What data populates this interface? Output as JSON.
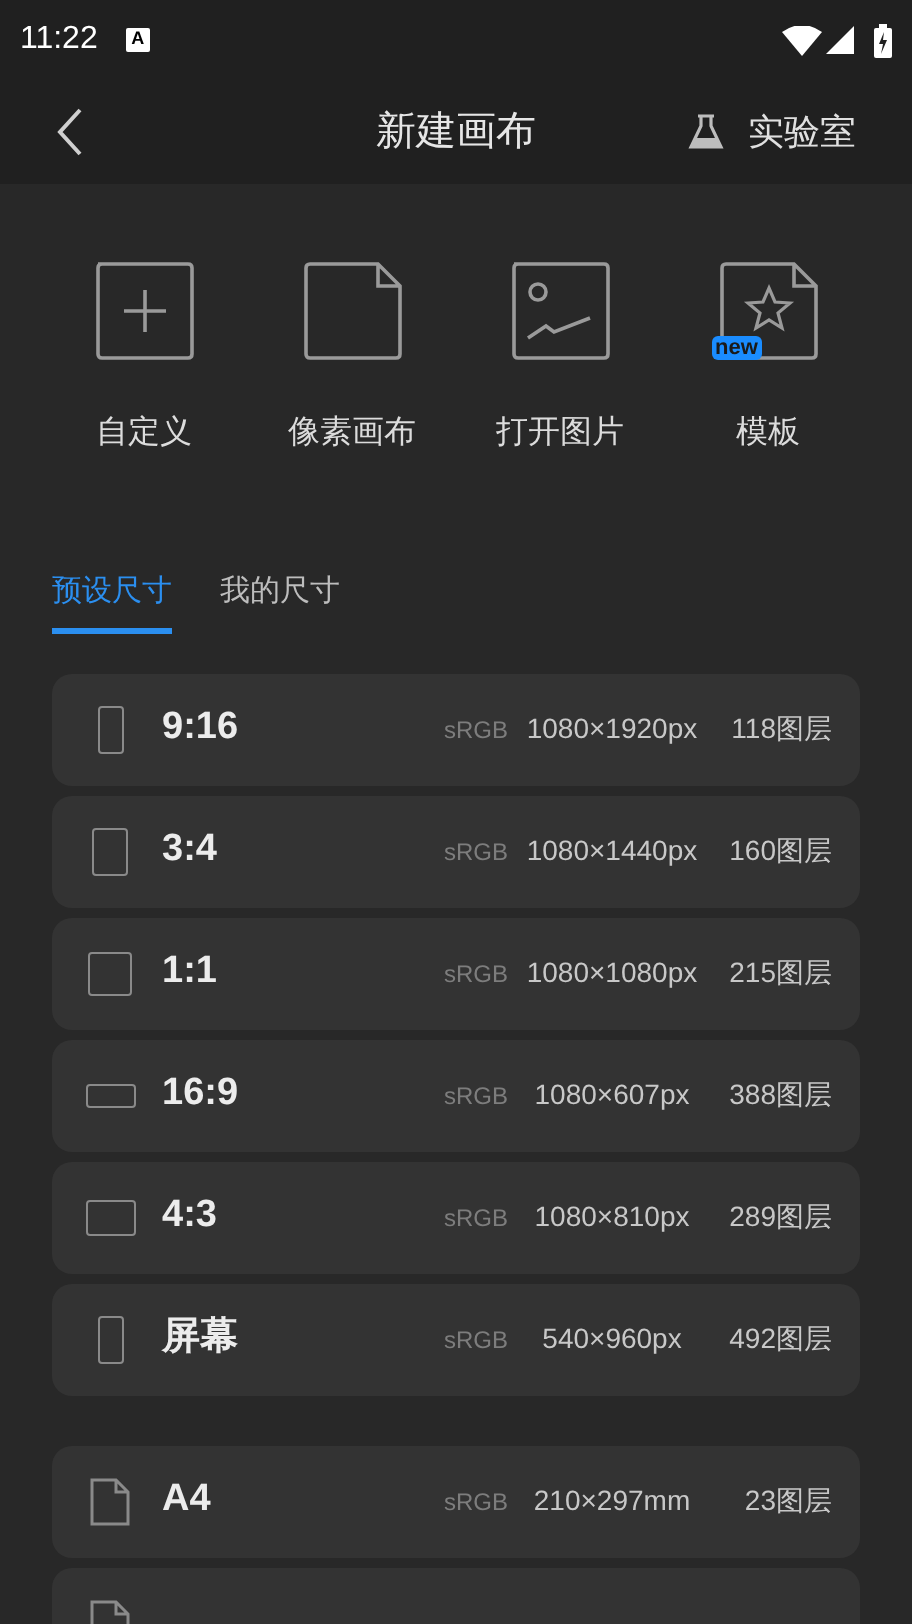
{
  "status_bar": {
    "time": "11:22",
    "notification": "A"
  },
  "header": {
    "title": "新建画布",
    "action": "实验室"
  },
  "actions": [
    {
      "kind": "plus",
      "label": "自定义"
    },
    {
      "kind": "page",
      "label": "像素画布"
    },
    {
      "kind": "image",
      "label": "打开图片"
    },
    {
      "kind": "star",
      "label": "模板",
      "badge": "new"
    }
  ],
  "tabs": [
    {
      "label": "预设尺寸",
      "selected": true
    },
    {
      "label": "我的尺寸",
      "selected": false
    }
  ],
  "groups": [
    [
      {
        "kind": "tall",
        "name": "9:16",
        "color_space": "sRGB",
        "size": "1080×1920px",
        "layers": "118图层"
      },
      {
        "kind": "portrait",
        "name": "3:4",
        "color_space": "sRGB",
        "size": "1080×1440px",
        "layers": "160图层"
      },
      {
        "kind": "square",
        "name": "1:1",
        "color_space": "sRGB",
        "size": "1080×1080px",
        "layers": "215图层"
      },
      {
        "kind": "wide",
        "name": "16:9",
        "color_space": "sRGB",
        "size": "1080×607px",
        "layers": "388图层"
      },
      {
        "kind": "landscape",
        "name": "4:3",
        "color_space": "sRGB",
        "size": "1080×810px",
        "layers": "289图层"
      },
      {
        "kind": "tall",
        "name": "屏幕",
        "color_space": "sRGB",
        "size": "540×960px",
        "layers": "492图层"
      }
    ],
    [
      {
        "kind": "page",
        "name": "A4",
        "color_space": "sRGB",
        "size": "210×297mm",
        "layers": "23图层"
      },
      {
        "kind": "page_cut"
      }
    ]
  ]
}
